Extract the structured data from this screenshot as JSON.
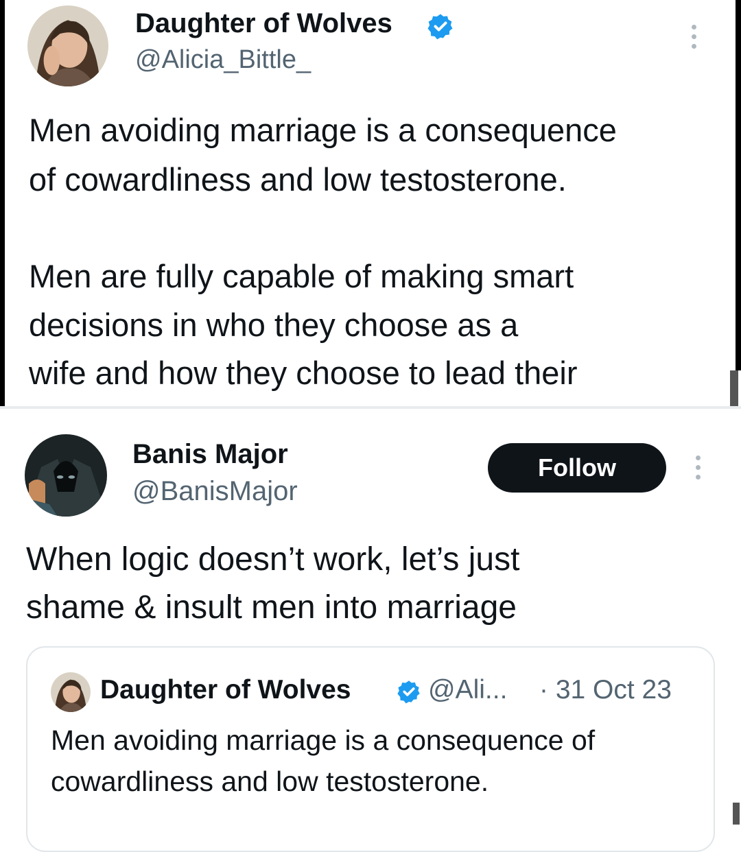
{
  "top_post": {
    "author_name": "Daughter of Wolves",
    "author_handle": "@Alicia_Bittle_",
    "text_lines": [
      "Men avoiding marriage is a consequence",
      "of cowardliness and low testosterone.",
      "Men are fully capable of making smart",
      "decisions in who they choose as a",
      "wife and how they choose to lead their"
    ]
  },
  "reply_post": {
    "author_name": "Banis Major",
    "author_handle": "@BanisMajor",
    "follow_label": "Follow",
    "text_lines": [
      "When logic doesn’t work, let’s just",
      "shame & insult men into marriage"
    ]
  },
  "quoted_post": {
    "author_name": "Daughter of Wolves",
    "author_handle": "@Ali...",
    "date": "· 31 Oct 23",
    "text_lines": [
      "Men avoiding marriage is a consequence of",
      "cowardliness and low testosterone."
    ]
  },
  "icons": {
    "verified": "verified-badge-icon",
    "more": "more-options-icon"
  },
  "colors": {
    "verified_blue": "#1d9bf0",
    "handle_gray": "#536471",
    "follow_bg": "#0f1419"
  }
}
